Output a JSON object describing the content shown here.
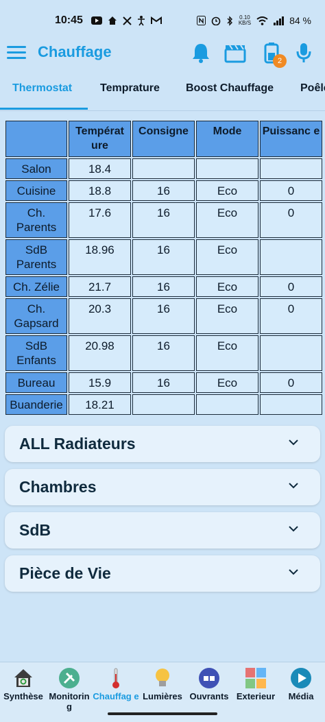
{
  "status_bar": {
    "time": "10:45",
    "net_speed_top": "0.10",
    "net_speed_unit": "KB/S",
    "battery": "84 %"
  },
  "app_bar": {
    "title": "Chauffage",
    "badge_count": "2",
    "accent_color": "#1a9be0"
  },
  "tabs": [
    {
      "label": "Thermostat",
      "active": true
    },
    {
      "label": "Temprature",
      "active": false
    },
    {
      "label": "Boost Chauffage",
      "active": false
    },
    {
      "label": "Poêle",
      "active": false
    }
  ],
  "table": {
    "headers": [
      "",
      "Températ ure",
      "Consigne",
      "Mode",
      "Puissanc e"
    ],
    "rows": [
      {
        "room": "Salon",
        "temp": "18.4",
        "consigne": "",
        "mode": "",
        "puissance": ""
      },
      {
        "room": "Cuisine",
        "temp": "18.8",
        "consigne": "16",
        "mode": "Eco",
        "puissance": "0"
      },
      {
        "room": "Ch. Parents",
        "temp": "17.6",
        "consigne": "16",
        "mode": "Eco",
        "puissance": "0"
      },
      {
        "room": "SdB Parents",
        "temp": "18.96",
        "consigne": "16",
        "mode": "Eco",
        "puissance": ""
      },
      {
        "room": "Ch. Zélie",
        "temp": "21.7",
        "consigne": "16",
        "mode": "Eco",
        "puissance": "0"
      },
      {
        "room": "Ch. Gapsard",
        "temp": "20.3",
        "consigne": "16",
        "mode": "Eco",
        "puissance": "0"
      },
      {
        "room": "SdB Enfants",
        "temp": "20.98",
        "consigne": "16",
        "mode": "Eco",
        "puissance": ""
      },
      {
        "room": "Bureau",
        "temp": "15.9",
        "consigne": "16",
        "mode": "Eco",
        "puissance": "0"
      },
      {
        "room": "Buanderie",
        "temp": "18.21",
        "consigne": "",
        "mode": "",
        "puissance": ""
      }
    ]
  },
  "accordions": [
    {
      "label": "ALL Radiateurs"
    },
    {
      "label": "Chambres"
    },
    {
      "label": "SdB"
    },
    {
      "label": "Pièce de Vie"
    }
  ],
  "bottom_nav": [
    {
      "label": "Synthèse",
      "icon": "house-icon",
      "active": false
    },
    {
      "label": "Monitorin g",
      "icon": "tools-icon",
      "active": false
    },
    {
      "label": "Chauffag e",
      "icon": "thermometer-icon",
      "active": true
    },
    {
      "label": "Lumières",
      "icon": "lightbulb-icon",
      "active": false
    },
    {
      "label": "Ouvrants",
      "icon": "door-sensor-icon",
      "active": false
    },
    {
      "label": "Exterieur",
      "icon": "garden-icon",
      "active": false
    },
    {
      "label": "Média",
      "icon": "play-icon",
      "active": false
    }
  ]
}
